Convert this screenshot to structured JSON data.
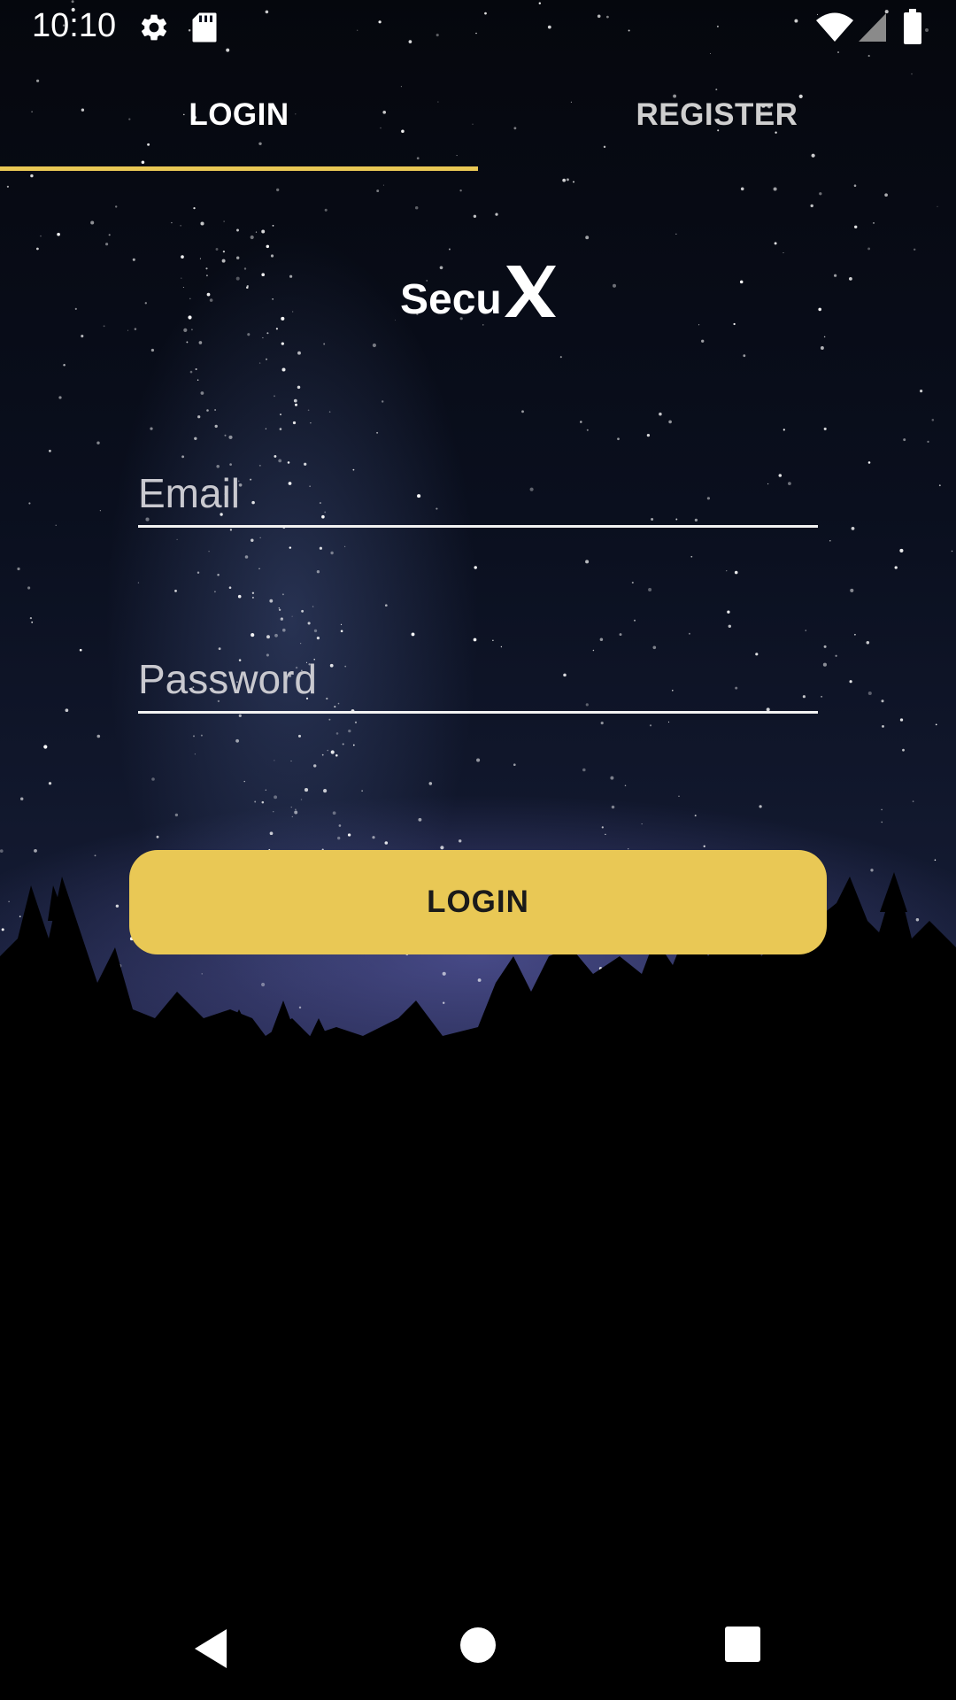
{
  "status_bar": {
    "time": "10:10",
    "icons": [
      "gear-icon",
      "sd-card-icon",
      "wifi-icon",
      "signal-icon",
      "battery-icon"
    ]
  },
  "tabs": [
    {
      "label": "LOGIN",
      "selected": true
    },
    {
      "label": "REGISTER",
      "selected": false
    }
  ],
  "logo": {
    "text": "SecuX"
  },
  "form": {
    "email_placeholder": "Email",
    "email_value": "",
    "password_placeholder": "Password",
    "password_value": "",
    "login_label": "LOGIN"
  },
  "nav_bar": {
    "icons": [
      "back-icon",
      "home-icon",
      "recents-icon"
    ]
  },
  "colors": {
    "accent": "#e9c855",
    "text_primary": "#ffffff",
    "text_inactive": "#cfcfcf"
  }
}
